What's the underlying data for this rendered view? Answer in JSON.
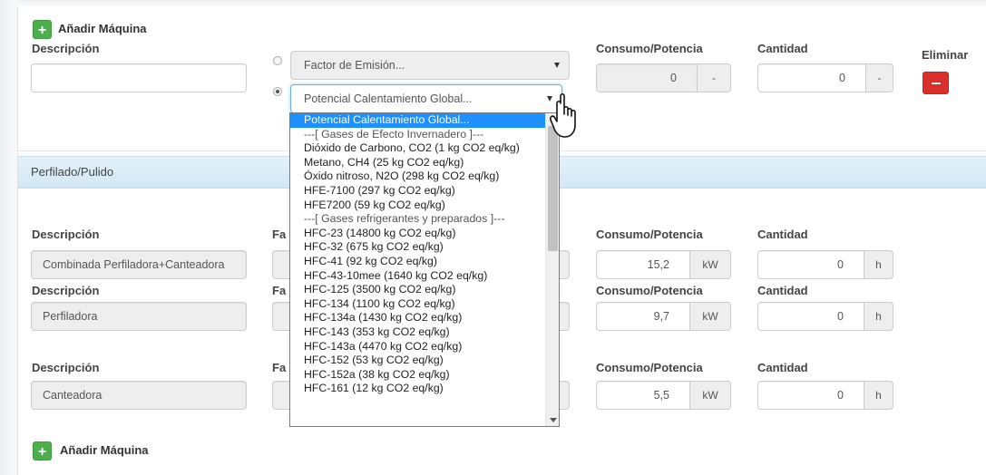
{
  "top_form": {
    "add_button": "Añadir Máquina",
    "description_label": "Descripción",
    "description_value": "",
    "select_factor": "Factor de Emisión...",
    "select_potencial": "Potencial Calentamiento Global...",
    "consumo_label": "Consumo/Potencia",
    "consumo_value": "0",
    "consumo_unit": "-",
    "cantidad_label": "Cantidad",
    "cantidad_value": "0",
    "cantidad_unit": "-",
    "eliminar_label": "Eliminar"
  },
  "section": {
    "title": "Perfilado/Pulido",
    "rows": [
      {
        "description_label": "Descripción",
        "factor_label": "Fa",
        "description": "Combinada Perfiladora+Canteadora",
        "consumo_label": "Consumo/Potencia",
        "consumo": "15,2",
        "consumo_unit": "kW",
        "cantidad_label": "Cantidad",
        "cantidad": "0",
        "cantidad_unit": "h"
      },
      {
        "description_label": "Descripción",
        "factor_label": "Fa",
        "description": "Perfiladora",
        "consumo_label": "Consumo/Potencia",
        "consumo": "9,7",
        "consumo_unit": "kW",
        "cantidad_label": "Cantidad",
        "cantidad": "0",
        "cantidad_unit": "h"
      },
      {
        "description_label": "Descripción",
        "factor_label": "Fa",
        "description": "Canteadora",
        "consumo_label": "Consumo/Potencia",
        "consumo": "5,5",
        "consumo_unit": "kW",
        "cantidad_label": "Cantidad",
        "cantidad": "0",
        "cantidad_unit": "h"
      }
    ],
    "add_button": "Añadir Máquina"
  },
  "dropdown": {
    "items": [
      "Potencial Calentamiento Global...",
      "---[ Gases de Efecto Invernadero ]---",
      "Dióxido de Carbono, CO2 (1 kg CO2 eq/kg)",
      "Metano, CH4 (25 kg CO2 eq/kg)",
      "Óxido nitroso, N2O (298 kg CO2 eq/kg)",
      "HFE-7100 (297 kg CO2 eq/kg)",
      "HFE7200 (59 kg CO2 eq/kg)",
      "---[ Gases refrigerantes y preparados ]---",
      "HFC-23 (14800 kg CO2 eq/kg)",
      "HFC-32 (675 kg CO2 eq/kg)",
      "HFC-41 (92 kg CO2 eq/kg)",
      "HFC-43-10mee (1640 kg CO2 eq/kg)",
      "HFC-125 (3500 kg CO2 eq/kg)",
      "HFC-134 (1100 kg CO2 eq/kg)",
      "HFC-134a (1430 kg CO2 eq/kg)",
      "HFC-143 (353 kg CO2 eq/kg)",
      "HFC-143a (4470 kg CO2 eq/kg)",
      "HFC-152 (53 kg CO2 eq/kg)",
      "HFC-152a (38 kg CO2 eq/kg)",
      "HFC-161 (12 kg CO2 eq/kg)"
    ]
  }
}
